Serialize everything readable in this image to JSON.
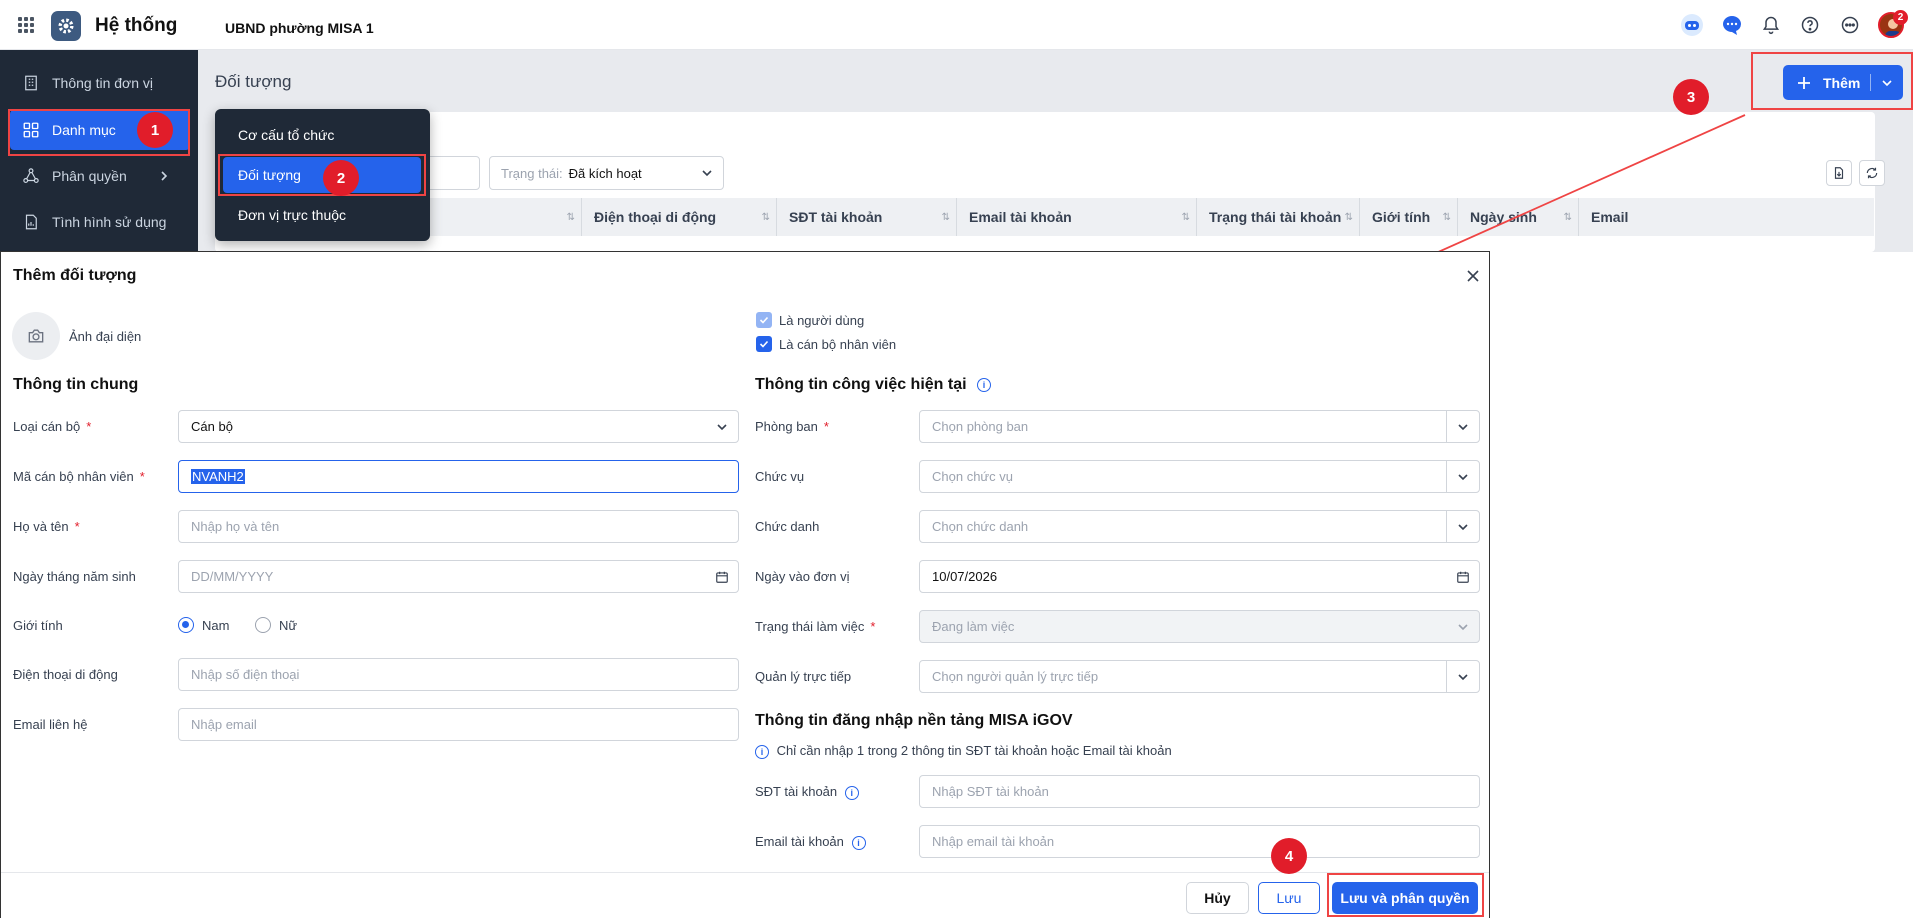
{
  "app": {
    "title": "Hệ thống",
    "org_name": "UBND phường MISA 1",
    "notification_count": "2"
  },
  "sidebar": {
    "items": [
      {
        "label": "Thông tin đơn vị",
        "icon": "building-icon"
      },
      {
        "label": "Danh mục",
        "icon": "grid-icon"
      },
      {
        "label": "Phân quyền",
        "icon": "share-nodes-icon"
      },
      {
        "label": "Tình hình sử dụng",
        "icon": "report-icon"
      }
    ]
  },
  "page": {
    "title": "Đối tượng",
    "add_button": "Thêm"
  },
  "dropdown": {
    "items": [
      "Cơ cấu tổ chức",
      "Đối tượng",
      "Đơn vị trực thuộc"
    ]
  },
  "filter": {
    "status_label": "Trạng thái:",
    "status_value": "Đã kích hoạt"
  },
  "table": {
    "columns": [
      "Điện thoại di động",
      "SĐT tài khoản",
      "Email tài khoản",
      "Trạng thái tài khoản",
      "Giới tính",
      "Ngày sinh",
      "Email"
    ]
  },
  "badges": [
    "1",
    "2",
    "3",
    "4"
  ],
  "modal": {
    "title": "Thêm đối tượng",
    "avatar_label": "Ảnh đại diện",
    "checkbox_user": "Là người dùng",
    "checkbox_staff": "Là cán bộ nhân viên",
    "general_section": "Thông tin chung",
    "work_section": "Thông tin công việc hiện tại",
    "login_section": "Thông tin đăng nhập nền tảng MISA iGOV",
    "login_note": "Chỉ cần nhập 1 trong 2 thông tin SĐT tài khoản hoặc Email tài khoản",
    "left_fields": [
      {
        "label": "Loại cán bộ",
        "required": "*",
        "value": "Cán bộ"
      },
      {
        "label": "Mã cán bộ nhân viên",
        "required": "*",
        "value": "NVANH2"
      },
      {
        "label": "Họ và tên",
        "required": "*",
        "placeholder": "Nhập họ và tên"
      },
      {
        "label": "Ngày tháng năm sinh",
        "placeholder": "DD/MM/YYYY"
      },
      {
        "label": "Giới tính",
        "options": [
          "Nam",
          "Nữ"
        ],
        "selected": "Nam"
      },
      {
        "label": "Điện thoại di động",
        "placeholder": "Nhập số điện thoại"
      },
      {
        "label": "Email liên hệ",
        "placeholder": "Nhập email"
      }
    ],
    "right_fields": [
      {
        "label": "Phòng ban",
        "required": "*",
        "placeholder": "Chọn phòng ban"
      },
      {
        "label": "Chức vụ",
        "placeholder": "Chọn chức vụ"
      },
      {
        "label": "Chức danh",
        "placeholder": "Chọn chức danh"
      },
      {
        "label": "Ngày vào đơn vị",
        "value": "10/07/2026"
      },
      {
        "label": "Trạng thái làm việc",
        "required": "*",
        "value": "Đang làm việc"
      },
      {
        "label": "Quản lý trực tiếp",
        "placeholder": "Chọn người quản lý trực tiếp"
      }
    ],
    "login_fields": [
      {
        "label": "SĐT tài khoản",
        "placeholder": "Nhập SĐT tài khoản"
      },
      {
        "label": "Email tài khoản",
        "placeholder": "Nhập email tài khoản"
      }
    ],
    "buttons": {
      "cancel": "Hủy",
      "save": "Lưu",
      "save_assign": "Lưu và phân quyền"
    }
  }
}
